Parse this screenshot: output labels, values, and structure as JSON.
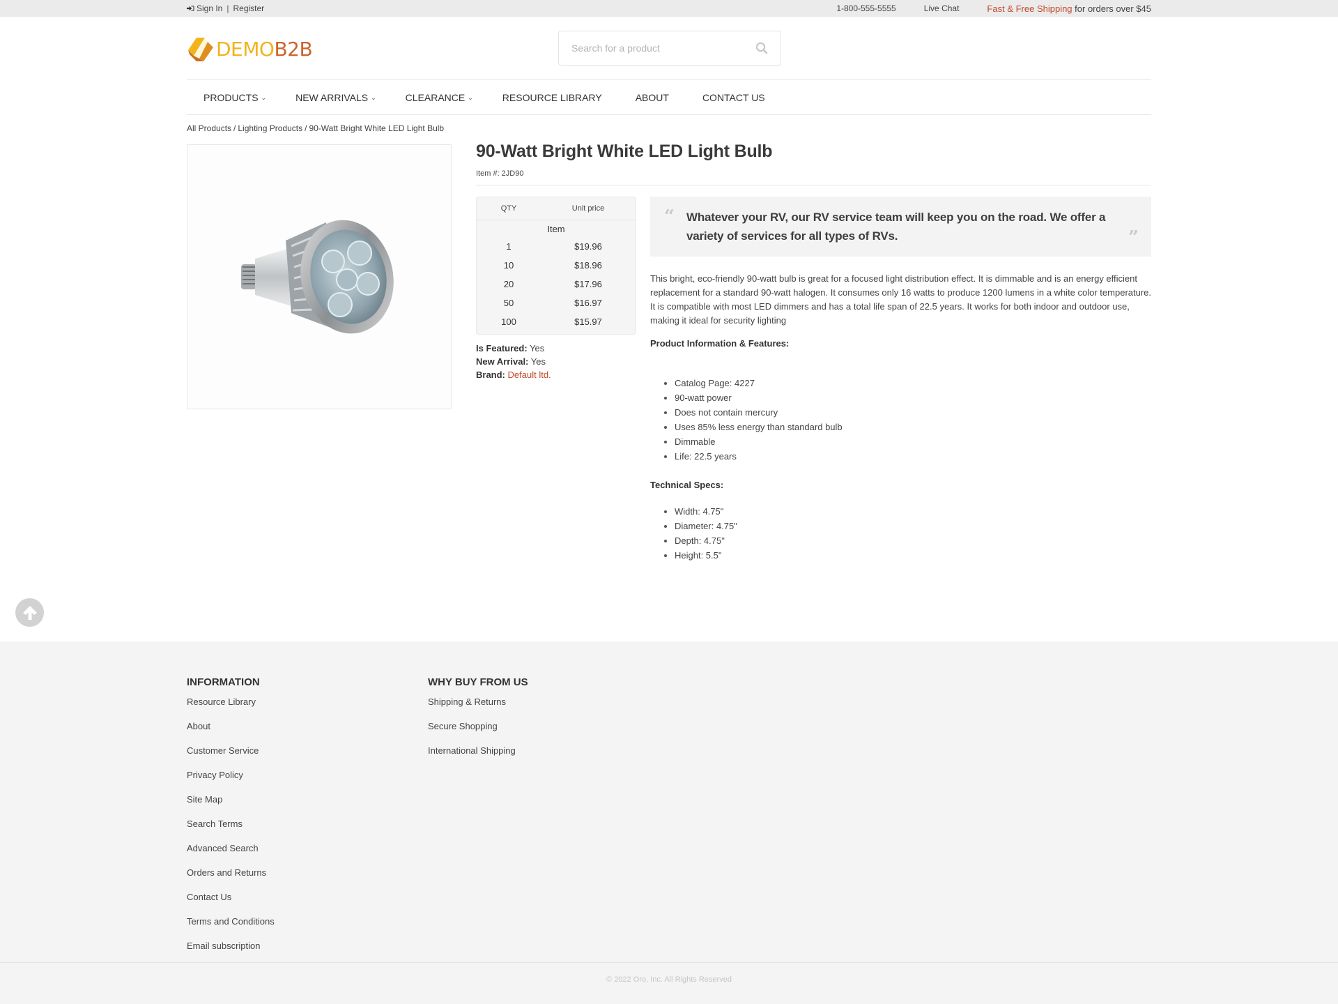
{
  "topbar": {
    "sign_in": "Sign In",
    "separator": "|",
    "register": "Register",
    "phone": "1-800-555-5555",
    "live_chat": "Live Chat",
    "shipping_link": "Fast & Free Shipping",
    "shipping_text": " for orders over $45"
  },
  "header": {
    "logo_demo": "DEMO",
    "logo_b2b": "B2B",
    "search_placeholder": "Search for a product",
    "search_value": ""
  },
  "nav": {
    "items": [
      {
        "label": "PRODUCTS",
        "has_dropdown": true
      },
      {
        "label": "NEW ARRIVALS",
        "has_dropdown": true
      },
      {
        "label": "CLEARANCE",
        "has_dropdown": true
      },
      {
        "label": "RESOURCE LIBRARY",
        "has_dropdown": false
      },
      {
        "label": "ABOUT",
        "has_dropdown": false
      },
      {
        "label": "CONTACT US",
        "has_dropdown": false
      }
    ],
    "dropdown_glyph": "⌄"
  },
  "breadcrumb": {
    "items": [
      "All Products",
      "Lighting Products",
      "90-Watt Bright White LED Light Bulb"
    ],
    "separator": "/"
  },
  "product": {
    "title": "90-Watt Bright White LED Light Bulb",
    "item_number": "Item #: 2JD90",
    "price_table": {
      "headers": [
        "QTY",
        "Unit price"
      ],
      "unit_group": "Item",
      "rows": [
        {
          "qty": "1",
          "price": "$19.96"
        },
        {
          "qty": "10",
          "price": "$18.96"
        },
        {
          "qty": "20",
          "price": "$17.96"
        },
        {
          "qty": "50",
          "price": "$16.97"
        },
        {
          "qty": "100",
          "price": "$15.97"
        }
      ]
    },
    "attributes": {
      "featured_label": "Is Featured:",
      "featured_value": " Yes",
      "new_arrival_label": "New Arrival:",
      "new_arrival_value": " Yes",
      "brand_label": "Brand:",
      "brand_value": "Default ltd."
    },
    "quote": "Whatever your RV, our RV service team will keep you on the road. We offer a variety of services for all types of RVs.",
    "description": "This bright, eco-friendly 90-watt bulb is great for a focused light distribution effect. It is dimmable and is an energy efficient replacement for a standard 90-watt halogen. It consumes only 16 watts to produce 1200 lumens in a white color temperature. It is compatible with most LED dimmers and has a total life span of 22.5 years. It works for both indoor and outdoor use, making it ideal for security lighting",
    "features_heading": "Product Information & Features:",
    "features": [
      "Catalog Page: 4227",
      "90-watt power",
      "Does not contain mercury",
      "Uses 85% less energy than standard bulb",
      "Dimmable",
      "Life: 22.5 years"
    ],
    "specs_heading": "Technical Specs:",
    "specs": [
      "Width: 4.75\"",
      "Diameter: 4.75\"",
      "Depth: 4.75\"",
      "Height: 5.5\""
    ]
  },
  "footer": {
    "information": {
      "heading": "INFORMATION",
      "links": [
        "Resource Library",
        "About",
        "Customer Service",
        "Privacy Policy",
        "Site Map",
        "Search Terms",
        "Advanced Search",
        "Orders and Returns",
        "Contact Us",
        "Terms and Conditions",
        "Email subscription"
      ]
    },
    "why_buy": {
      "heading": "WHY BUY FROM US",
      "links": [
        "Shipping & Returns",
        "Secure Shopping",
        "International Shipping"
      ]
    },
    "copyright": "© 2022 Oro, Inc. All Rights Reserved"
  },
  "colors": {
    "accent": "#c2492a",
    "logo_yellow": "#f1b31c",
    "logo_orange": "#c9652a",
    "topbar_bg": "#ebebeb",
    "footer_bg": "#f4f4f4"
  },
  "icons": {
    "sign_in": "sign-in-icon",
    "search": "search-icon",
    "quote_open": "quote-open-icon",
    "quote_close": "quote-close-icon",
    "scroll_top": "arrow-up-circle-icon"
  }
}
